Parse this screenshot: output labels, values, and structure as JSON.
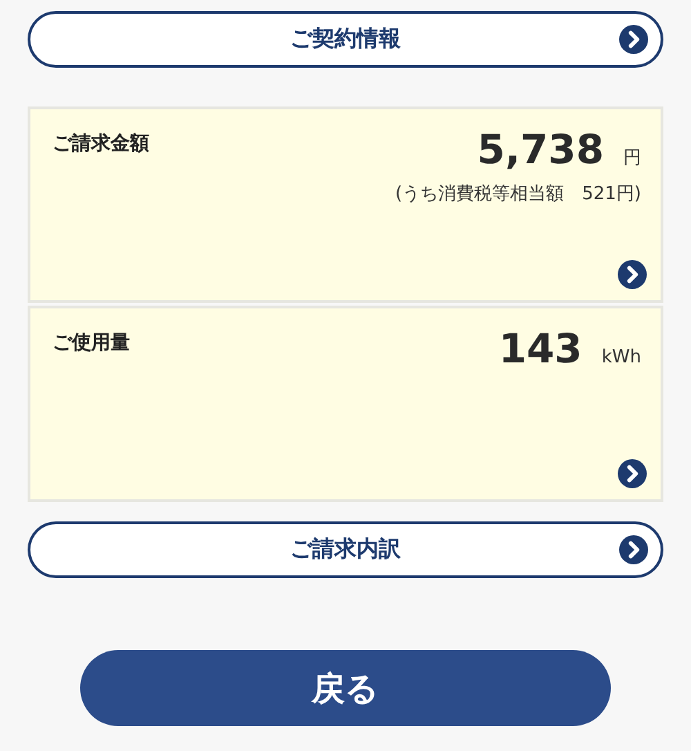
{
  "contract_button": {
    "label": "ご契約情報"
  },
  "cards": [
    {
      "title": "ご請求金額",
      "value": "5,738",
      "unit": "円",
      "note": "(うち消費税等相当額　521円)"
    },
    {
      "title": "ご使用量",
      "value": "143",
      "unit": "kWh"
    }
  ],
  "breakdown_button": {
    "label": "ご請求内訳"
  },
  "back_button": {
    "label": "戻る"
  }
}
